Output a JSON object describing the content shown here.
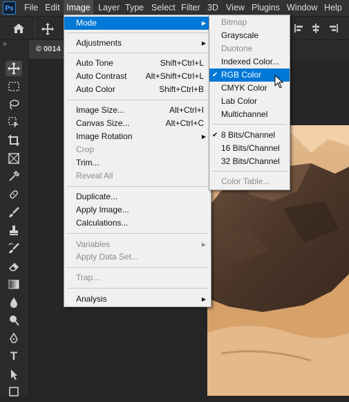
{
  "app": {
    "logo": "Ps"
  },
  "menubar": [
    "File",
    "Edit",
    "Image",
    "Layer",
    "Type",
    "Select",
    "Filter",
    "3D",
    "View",
    "Plugins",
    "Window",
    "Help"
  ],
  "tab": {
    "label": "© 0014",
    "collapse": "»"
  },
  "image_menu": {
    "mode": "Mode",
    "adjustments": "Adjustments",
    "auto_tone": "Auto Tone",
    "auto_tone_sc": "Shift+Ctrl+L",
    "auto_contrast": "Auto Contrast",
    "auto_contrast_sc": "Alt+Shift+Ctrl+L",
    "auto_color": "Auto Color",
    "auto_color_sc": "Shift+Ctrl+B",
    "image_size": "Image Size...",
    "image_size_sc": "Alt+Ctrl+I",
    "canvas_size": "Canvas Size...",
    "canvas_size_sc": "Alt+Ctrl+C",
    "image_rotation": "Image Rotation",
    "crop": "Crop",
    "trim": "Trim...",
    "reveal_all": "Reveal All",
    "duplicate": "Duplicate...",
    "apply_image": "Apply Image...",
    "calculations": "Calculations...",
    "variables": "Variables",
    "apply_data_set": "Apply Data Set...",
    "trap": "Trap...",
    "analysis": "Analysis"
  },
  "mode_menu": {
    "bitmap": "Bitmap",
    "grayscale": "Grayscale",
    "duotone": "Duotone",
    "indexed_color": "Indexed Color...",
    "rgb_color": "RGB Color",
    "cmyk_color": "CMYK Color",
    "lab_color": "Lab Color",
    "multichannel": "Multichannel",
    "bits8": "8 Bits/Channel",
    "bits16": "16 Bits/Channel",
    "bits32": "32 Bits/Channel",
    "color_table": "Color Table...",
    "check": "✔"
  },
  "tools": [
    "move-tool",
    "marquee-tool",
    "lasso-tool",
    "object-select-tool",
    "crop-tool",
    "frame-tool",
    "eyedropper-tool",
    "healing-brush-tool",
    "brush-tool",
    "clone-stamp-tool",
    "history-brush-tool",
    "eraser-tool",
    "gradient-tool",
    "blur-tool",
    "dodge-tool",
    "pen-tool",
    "type-tool",
    "path-select-tool",
    "rectangle-tool"
  ],
  "colors": {
    "highlight": "#0078d7",
    "menu_bg": "#f0f0f0",
    "chrome": "#323232"
  }
}
